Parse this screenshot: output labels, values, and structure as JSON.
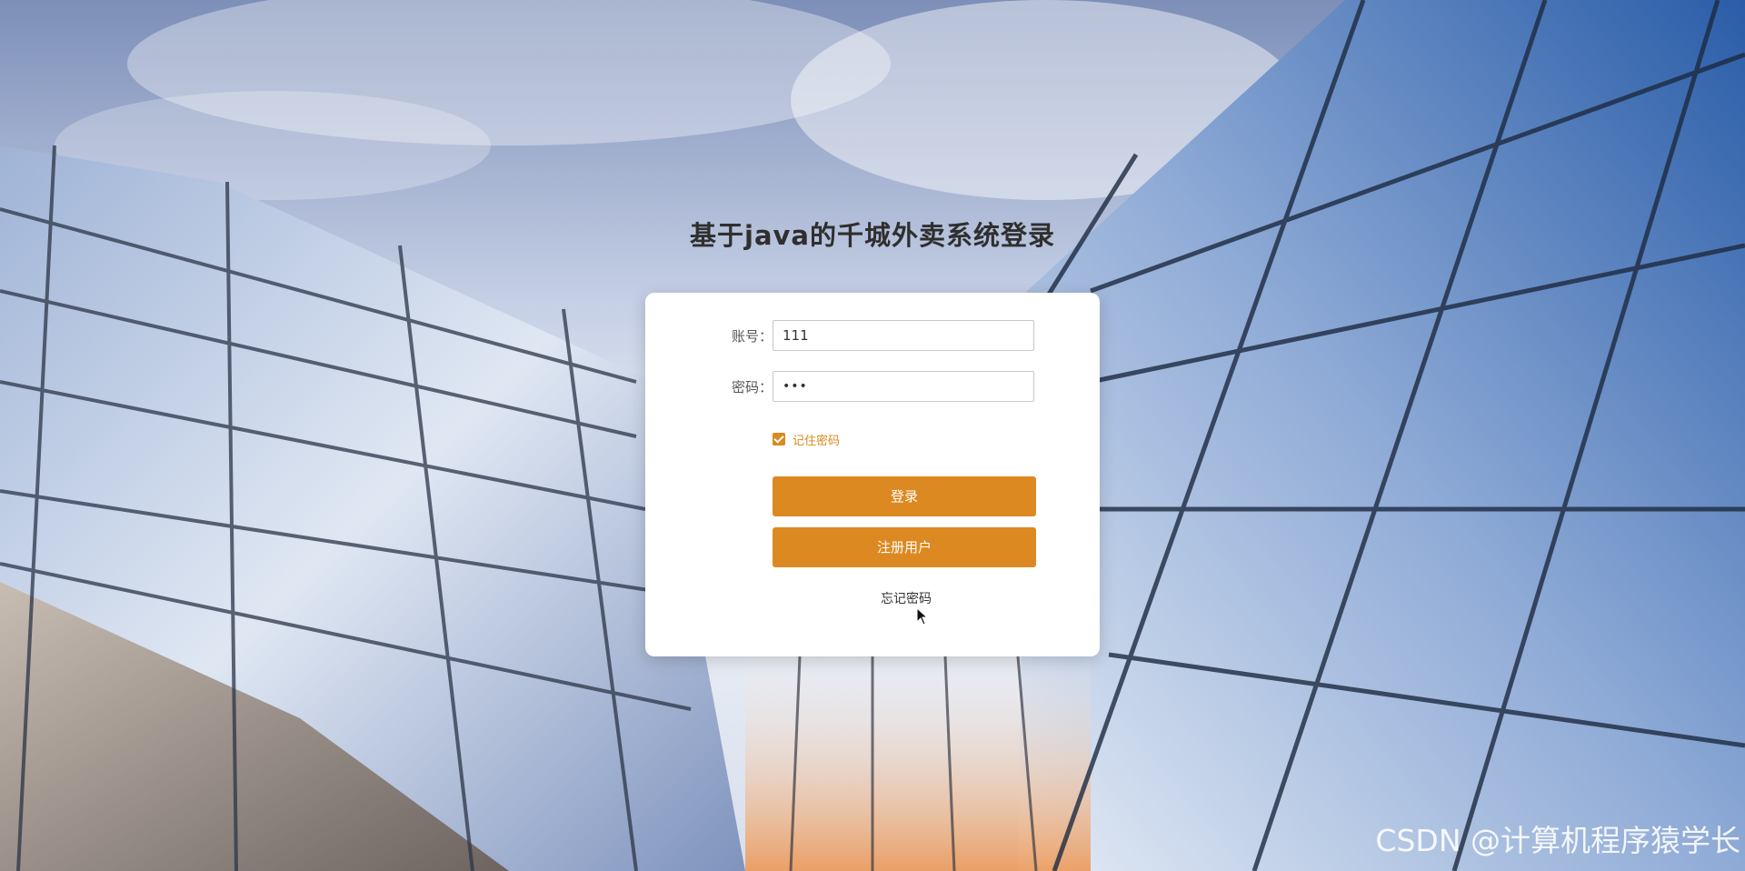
{
  "page": {
    "title": "基于java的千城外卖系统登录"
  },
  "login_form": {
    "account_label": "账号：",
    "account_value": "111",
    "password_label": "密码：",
    "password_value": "•••",
    "remember_label": "记住密码",
    "remember_checked": true,
    "login_button": "登录",
    "register_button": "注册用户",
    "forgot_link": "忘记密码"
  },
  "watermark": "CSDN @计算机程序猿学长",
  "colors": {
    "accent": "#dd8922",
    "card_bg": "#ffffff",
    "title_text": "#2f2f2f"
  },
  "icons": {
    "checkbox": "check-icon",
    "pointer": "mouse-pointer-icon"
  }
}
